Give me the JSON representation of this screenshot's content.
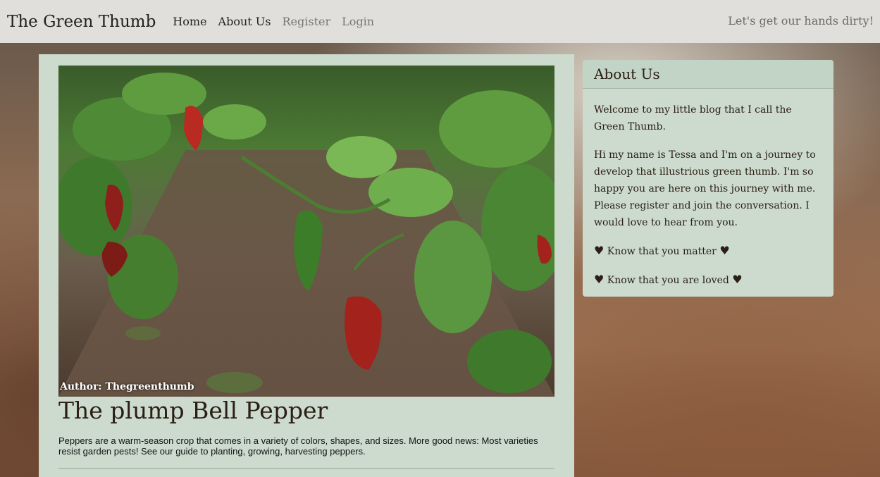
{
  "nav": {
    "brand": "The Green Thumb",
    "links": [
      {
        "label": "Home",
        "active": true
      },
      {
        "label": "About Us",
        "active": true
      },
      {
        "label": "Register",
        "active": false
      },
      {
        "label": "Login",
        "active": false
      }
    ],
    "tagline": "Let's get our hands dirty!"
  },
  "post": {
    "author": "Author: Thegreenthumb",
    "title": "The plump Bell Pepper",
    "excerpt": "Peppers are a warm-season crop that comes in a variety of colors, shapes, and sizes. More good news: Most varieties resist garden pests! See our guide to planting, growing, harvesting peppers."
  },
  "about": {
    "title": "About Us",
    "paragraph1": "Welcome to my little blog that I call the Green Thumb.",
    "paragraph2": "Hi my name is Tessa and I'm on a journey to develop that illustrious green thumb. I'm so happy you are here on this journey with me. Please register and join the conversation. I would love to hear from you.",
    "line1": "Know that you matter",
    "line2": "Know that you are loved"
  },
  "colors": {
    "nav_bg": "#e1dfdb",
    "card_bg": "#ccdbce",
    "text_dark": "#2b1e14"
  },
  "icons": [
    "heart-icon"
  ]
}
